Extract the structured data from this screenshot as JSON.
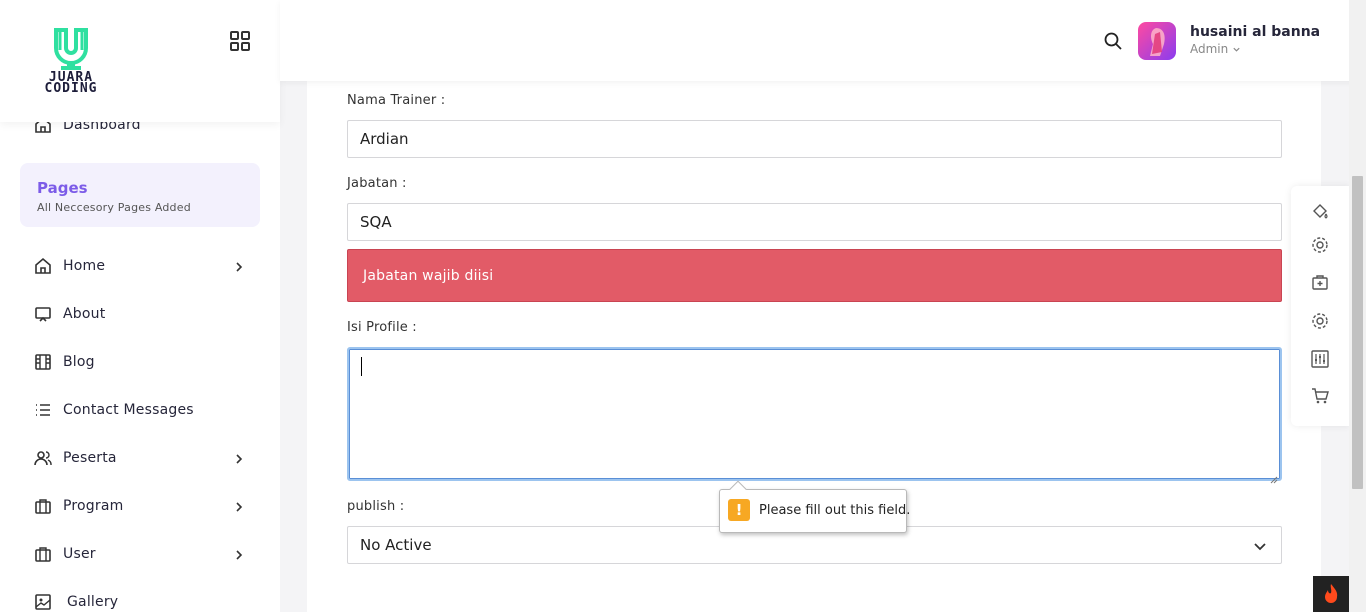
{
  "brand": {
    "logo_text_line1": "JUARA",
    "logo_text_line2": "CODING",
    "accent": "#2fe0a0"
  },
  "sidebar": {
    "dashboard_label": "Dashboard",
    "pages_card": {
      "title": "Pages",
      "subtitle": "All Neccesory Pages Added"
    },
    "items": [
      {
        "label": "Home",
        "icon": "home-icon",
        "has_submenu": true
      },
      {
        "label": "About",
        "icon": "monitor-icon",
        "has_submenu": false
      },
      {
        "label": "Blog",
        "icon": "film-icon",
        "has_submenu": false
      },
      {
        "label": "Contact Messages",
        "icon": "list-icon",
        "has_submenu": false
      },
      {
        "label": "Peserta",
        "icon": "users-icon",
        "has_submenu": true
      },
      {
        "label": "Program",
        "icon": "briefcase-icon",
        "has_submenu": true
      },
      {
        "label": "User",
        "icon": "briefcase-icon",
        "has_submenu": true
      },
      {
        "label": "Gallery",
        "icon": "image-icon",
        "has_submenu": false
      }
    ]
  },
  "topbar": {
    "user_name": "husaini al banna",
    "user_role": "Admin"
  },
  "form": {
    "nama_trainer_label": "Nama Trainer :",
    "nama_trainer_value": "Ardian",
    "jabatan_label": "Jabatan :",
    "jabatan_value": "SQA",
    "jabatan_error": "Jabatan wajib diisi",
    "isi_profile_label": "Isi Profile :",
    "isi_profile_value": "",
    "publish_label": "publish :",
    "publish_value": "No Active"
  },
  "validation_tooltip": {
    "text": "Please fill out this field."
  },
  "colors": {
    "error": "#e25b67",
    "pages_accent": "#7c5ce8",
    "focus_border": "#9cc4ef",
    "warning": "#f7a823"
  }
}
